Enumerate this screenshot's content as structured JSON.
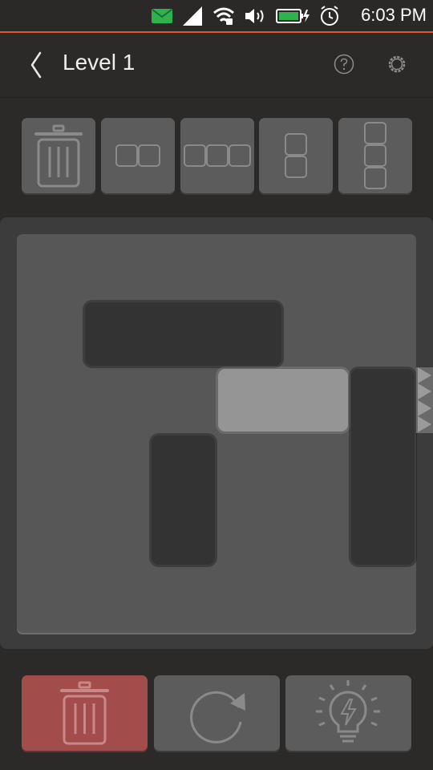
{
  "status_bar": {
    "time": "6:03 PM",
    "icons": [
      "message-icon",
      "signal-icon",
      "wifi-icon",
      "volume-icon",
      "battery-charging-icon",
      "alarm-icon"
    ]
  },
  "header": {
    "title": "Level 1",
    "back_icon": "chevron-left-icon",
    "help_icon": "help-icon",
    "settings_icon": "settings-icon"
  },
  "palette": {
    "items": [
      {
        "name": "delete-tool",
        "icon": "trash-icon"
      },
      {
        "name": "horizontal-2-block",
        "icon": "horizontal-2-icon"
      },
      {
        "name": "horizontal-3-block",
        "icon": "horizontal-3-icon"
      },
      {
        "name": "vertical-2-block",
        "icon": "vertical-2-icon"
      },
      {
        "name": "vertical-3-block",
        "icon": "vertical-3-icon"
      }
    ]
  },
  "board": {
    "grid": {
      "columns": 6,
      "rows": 6
    },
    "exit_row": 2,
    "blocks": [
      {
        "id": "block-a",
        "orientation": "horizontal",
        "length": 3,
        "col": 1,
        "row": 1,
        "target": false
      },
      {
        "id": "target-block",
        "orientation": "horizontal",
        "length": 2,
        "col": 3,
        "row": 2,
        "target": true
      },
      {
        "id": "block-b",
        "orientation": "vertical",
        "length": 3,
        "col": 5,
        "row": 2,
        "target": false
      },
      {
        "id": "block-c",
        "orientation": "vertical",
        "length": 2,
        "col": 2,
        "row": 3,
        "target": false
      }
    ]
  },
  "actions": {
    "clear": {
      "icon": "trash-icon",
      "color": "#a34c4c"
    },
    "reset": {
      "icon": "refresh-icon"
    },
    "hint": {
      "icon": "lightbulb-icon"
    }
  },
  "colors": {
    "background": "#2b2a28",
    "accent": "#e2562b",
    "board": "#575757",
    "board_frame": "#3c3c3c",
    "block": "#333333",
    "target_block": "#959595",
    "button": "#5c5c5c",
    "clear_button": "#a34c4c"
  }
}
